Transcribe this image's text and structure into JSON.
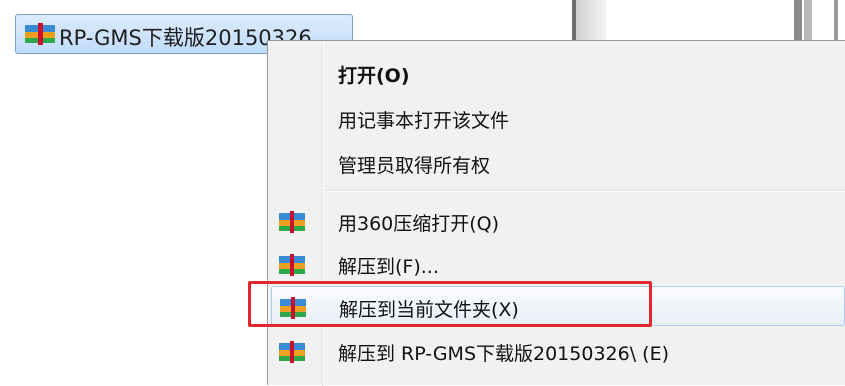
{
  "file": {
    "name": "RP-GMS下载版20150326",
    "icon": "archive-icon"
  },
  "menu": {
    "items": [
      {
        "label": "打开(O)",
        "bold": true,
        "icon": null
      },
      {
        "label": "用记事本打开该文件",
        "icon": null
      },
      {
        "label": "管理员取得所有权",
        "icon": null
      },
      {
        "label": "用360压缩打开(Q)",
        "icon": "archive-icon"
      },
      {
        "label": "解压到(F)...",
        "icon": "archive-icon"
      },
      {
        "label": "解压到当前文件夹(X)",
        "icon": "archive-icon",
        "highlighted": true
      },
      {
        "label": "解压到 RP-GMS下载版20150326\\ (E)",
        "icon": "archive-icon"
      }
    ]
  },
  "colors": {
    "highlight_border": "#e0282e",
    "selection": "#c1dcfc"
  }
}
